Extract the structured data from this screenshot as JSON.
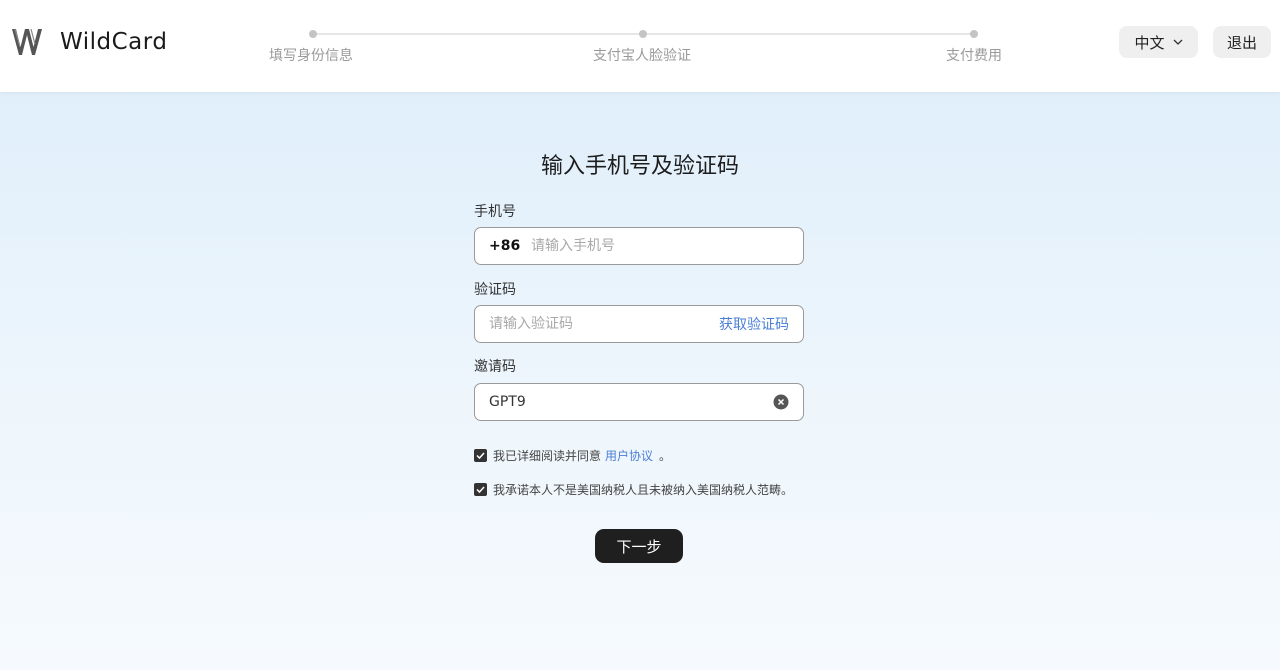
{
  "header": {
    "brand": "WildCard",
    "steps": [
      {
        "label": "填写身份信息"
      },
      {
        "label": "支付宝人脸验证"
      },
      {
        "label": "支付费用"
      }
    ],
    "language": "中文",
    "logout": "退出"
  },
  "form": {
    "title": "输入手机号及验证码",
    "phone": {
      "label": "手机号",
      "prefix": "+86",
      "placeholder": "请输入手机号",
      "value": ""
    },
    "code": {
      "label": "验证码",
      "placeholder": "请输入验证码",
      "get_code": "获取验证码",
      "value": ""
    },
    "invite": {
      "label": "邀请码",
      "value": "GPT9"
    },
    "agree": {
      "text": "我已详细阅读并同意",
      "link": "用户协议",
      "suffix": "。",
      "checked": true
    },
    "pledge": {
      "text": "我承诺本人不是美国纳税人且未被纳入美国纳税人范畴。",
      "checked": true
    },
    "next": "下一步"
  },
  "icons": {
    "logo": "wildcard-logo",
    "language_chevron": "chevron-down-icon",
    "clear": "clear-icon",
    "check": "check-icon"
  }
}
